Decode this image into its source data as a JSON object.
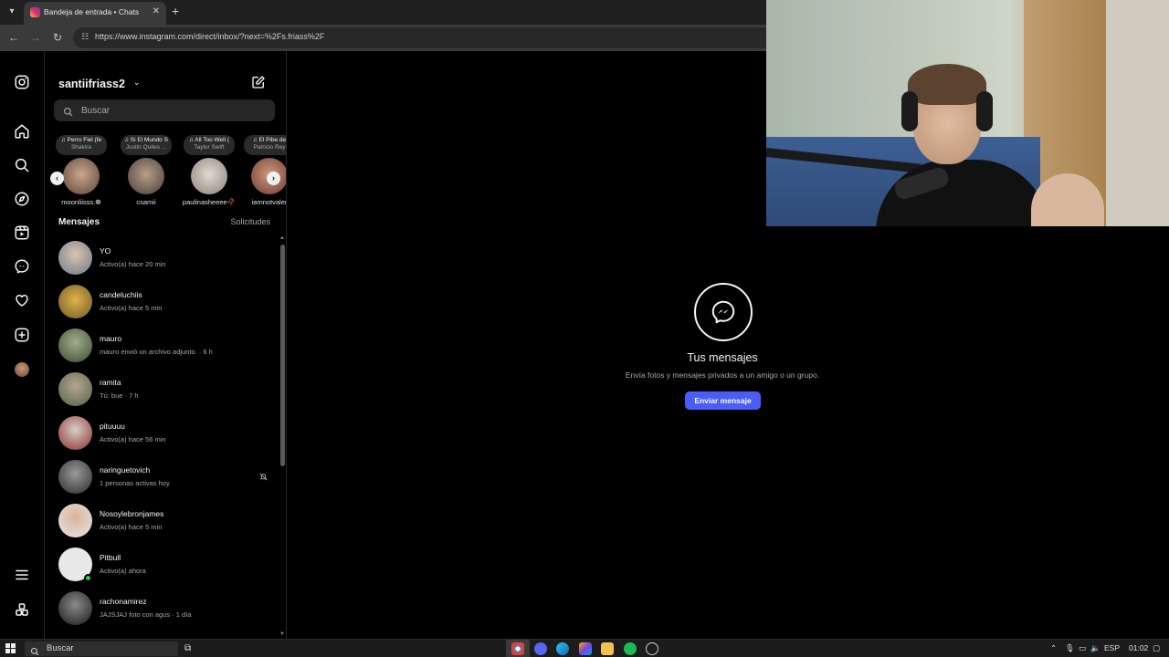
{
  "browser": {
    "tab_title": "Bandeja de entrada • Chats",
    "tab_close": "✕",
    "new_tab": "+",
    "url": "https://www.instagram.com/direct/inbox/?next=%2Fs.friass%2F"
  },
  "sidebar": {
    "username": "santiifriass2",
    "caret": "⌄",
    "search_placeholder": "Buscar"
  },
  "notes": [
    {
      "song": "♫ Perro Fiel (fe",
      "artist": "Shakira",
      "name": "moonliisss.❁",
      "color": "#8a6a55"
    },
    {
      "song": "♫ Si El Mundo S",
      "artist": "Justin Quiles ...",
      "name": "csamii",
      "color": "#6b5a50"
    },
    {
      "song": "♫ All Too Well (",
      "artist": "Taylor Swift",
      "name": "paulinasheeee🥀",
      "color": "#9d8f85"
    },
    {
      "song": "♫ El Pibe de",
      "artist": "Patricio Rey",
      "name": "iamnotvaler",
      "color": "#7b4d40"
    }
  ],
  "section": {
    "messages_label": "Mensajes",
    "requests_label": "Solicitudes"
  },
  "conversations": [
    {
      "name": "YO",
      "sub": "Activo(a) hace 20 min",
      "color": "#9aa3b0",
      "online": false,
      "muted": false
    },
    {
      "name": "candeluchiis",
      "sub": "Activo(a) hace 5 min",
      "color": "#b88b3a",
      "online": false,
      "muted": false
    },
    {
      "name": "mauro",
      "sub": "mauro envió un archivo adjunto. · 6 h",
      "color": "#6e7a5a",
      "online": false,
      "muted": false
    },
    {
      "name": "ramita",
      "sub": "Tú: bue · 7 h",
      "color": "#7f8a6b",
      "online": false,
      "muted": false
    },
    {
      "name": "pituuuu",
      "sub": "Activo(a) hace 56 min",
      "color": "#8b2e2e",
      "online": false,
      "muted": false
    },
    {
      "name": "naringuetovich",
      "sub": "1 personas activas hoy",
      "color": "#5b5b5b",
      "online": false,
      "muted": true
    },
    {
      "name": "Nosoylebronjames",
      "sub": "Activo(a) hace 5 min",
      "color": "#c9c2bb",
      "online": false,
      "muted": false
    },
    {
      "name": "Pitbull",
      "sub": "Activo(a) ahora",
      "color": "#e8e8e8",
      "online": true,
      "muted": false
    },
    {
      "name": "rachonamirez",
      "sub": "JAJSJAJ foto con agus · 1 día",
      "color": "#3d3d3d",
      "online": false,
      "muted": false
    }
  ],
  "empty_state": {
    "title": "Tus mensajes",
    "subtitle": "Envía fotos y mensajes privados a un amigo o un grupo.",
    "button": "Enviar mensaje"
  },
  "taskbar": {
    "search": "Buscar",
    "lang": "ESP",
    "time": "01:02"
  },
  "colors": {
    "accent": "#4a5df9",
    "background": "#000000",
    "secondary_text": "#a8a8a8"
  }
}
